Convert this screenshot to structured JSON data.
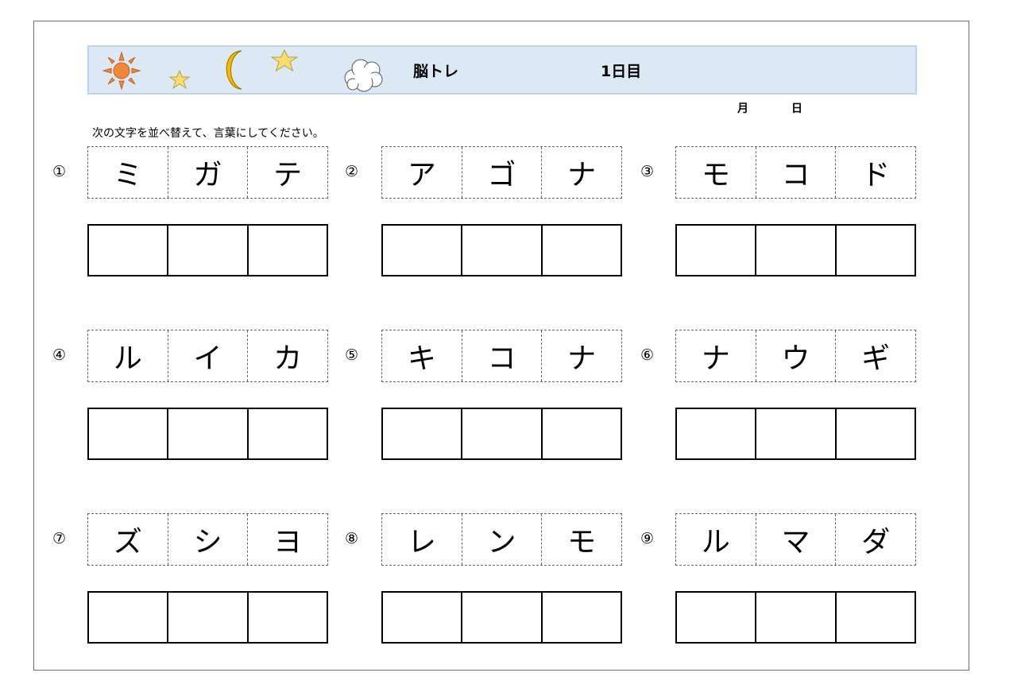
{
  "header": {
    "title": "脳トレ",
    "day": "1日目",
    "icons": [
      "sun-icon",
      "small-star-icon",
      "crescent-moon-icon",
      "star-icon",
      "cloud-icon"
    ]
  },
  "date": {
    "month_label": "月",
    "day_label": "日"
  },
  "instruction": "次の文字を並べ替えて、言葉にしてください。",
  "questions": [
    {
      "number": "①",
      "letters": [
        "ミ",
        "ガ",
        "テ"
      ]
    },
    {
      "number": "②",
      "letters": [
        "ア",
        "ゴ",
        "ナ"
      ]
    },
    {
      "number": "③",
      "letters": [
        "モ",
        "コ",
        "ド"
      ]
    },
    {
      "number": "④",
      "letters": [
        "ル",
        "イ",
        "カ"
      ]
    },
    {
      "number": "⑤",
      "letters": [
        "キ",
        "コ",
        "ナ"
      ]
    },
    {
      "number": "⑥",
      "letters": [
        "ナ",
        "ウ",
        "ギ"
      ]
    },
    {
      "number": "⑦",
      "letters": [
        "ズ",
        "シ",
        "ヨ"
      ]
    },
    {
      "number": "⑧",
      "letters": [
        "レ",
        "ン",
        "モ"
      ]
    },
    {
      "number": "⑨",
      "letters": [
        "ル",
        "マ",
        "ダ"
      ]
    }
  ],
  "colors": {
    "header_bg": "#dce9f5",
    "header_border": "#b9d4ef",
    "sun": "#f0873a",
    "star": "#f7dc6f",
    "moon": "#f5b800"
  }
}
